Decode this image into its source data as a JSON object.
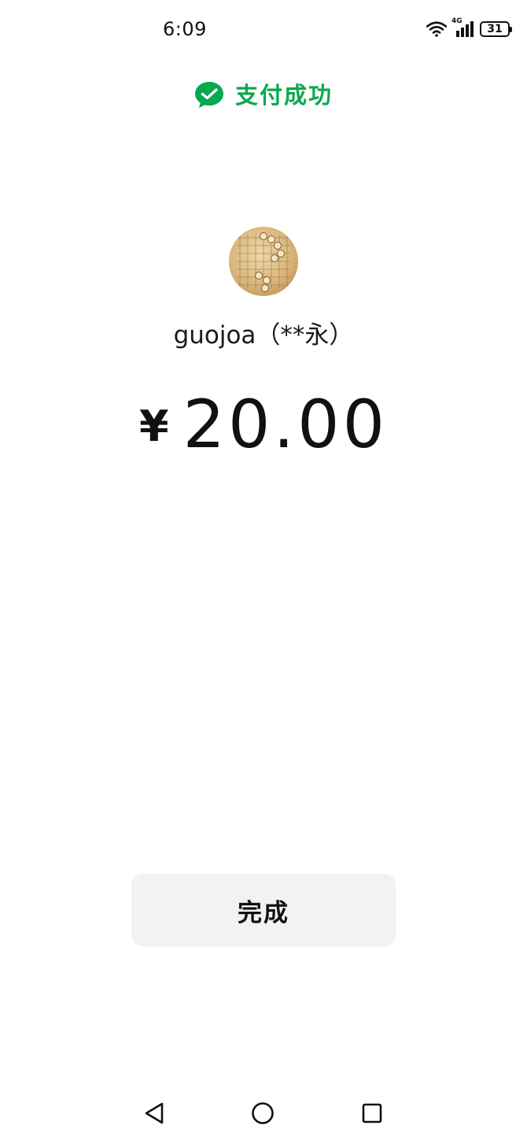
{
  "status_bar": {
    "time": "6:09",
    "network_label": "4G",
    "battery_level": "31",
    "icons": [
      "wifi-icon",
      "signal-icon",
      "battery-icon"
    ]
  },
  "header": {
    "title": "支付成功",
    "icon": "wechat-pay-icon",
    "accent_color": "#07a94e"
  },
  "payee": {
    "avatar": "avatar",
    "name": "guojoa（**永）"
  },
  "amount": {
    "currency_symbol": "¥",
    "value": "20.00"
  },
  "actions": {
    "done_label": "完成"
  },
  "nav_bar": {
    "icons": [
      "back-icon",
      "home-icon",
      "recents-icon"
    ]
  }
}
